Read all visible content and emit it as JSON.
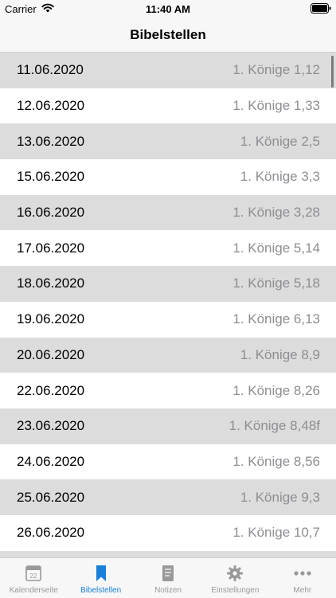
{
  "status_bar": {
    "carrier": "Carrier",
    "time": "11:40 AM"
  },
  "nav": {
    "title": "Bibelstellen"
  },
  "rows": [
    {
      "date": "11.06.2020",
      "ref": "1. Könige 1,12"
    },
    {
      "date": "12.06.2020",
      "ref": "1. Könige 1,33"
    },
    {
      "date": "13.06.2020",
      "ref": "1. Könige 2,5"
    },
    {
      "date": "15.06.2020",
      "ref": "1. Könige 3,3"
    },
    {
      "date": "16.06.2020",
      "ref": "1. Könige 3,28"
    },
    {
      "date": "17.06.2020",
      "ref": "1. Könige 5,14"
    },
    {
      "date": "18.06.2020",
      "ref": "1. Könige 5,18"
    },
    {
      "date": "19.06.2020",
      "ref": "1. Könige 6,13"
    },
    {
      "date": "20.06.2020",
      "ref": "1. Könige 8,9"
    },
    {
      "date": "22.06.2020",
      "ref": "1. Könige 8,26"
    },
    {
      "date": "23.06.2020",
      "ref": "1. Könige 8,48f"
    },
    {
      "date": "24.06.2020",
      "ref": "1. Könige 8,56"
    },
    {
      "date": "25.06.2020",
      "ref": "1. Könige 9,3"
    },
    {
      "date": "26.06.2020",
      "ref": "1. Könige 10,7"
    },
    {
      "date": "",
      "ref": ""
    }
  ],
  "tabs": [
    {
      "label": "Kalenderseite",
      "icon": "calendar-icon",
      "active": false,
      "calendar_day": "22"
    },
    {
      "label": "Bibelstellen",
      "icon": "bookmark-icon",
      "active": true
    },
    {
      "label": "Notizen",
      "icon": "notes-icon",
      "active": false
    },
    {
      "label": "Einstellungen",
      "icon": "gear-icon",
      "active": false
    },
    {
      "label": "Mehr",
      "icon": "more-icon",
      "active": false
    }
  ],
  "colors": {
    "accent": "#1a7fd7",
    "row_alt": "#dcdcdc",
    "secondary_text": "#8e8e93"
  }
}
